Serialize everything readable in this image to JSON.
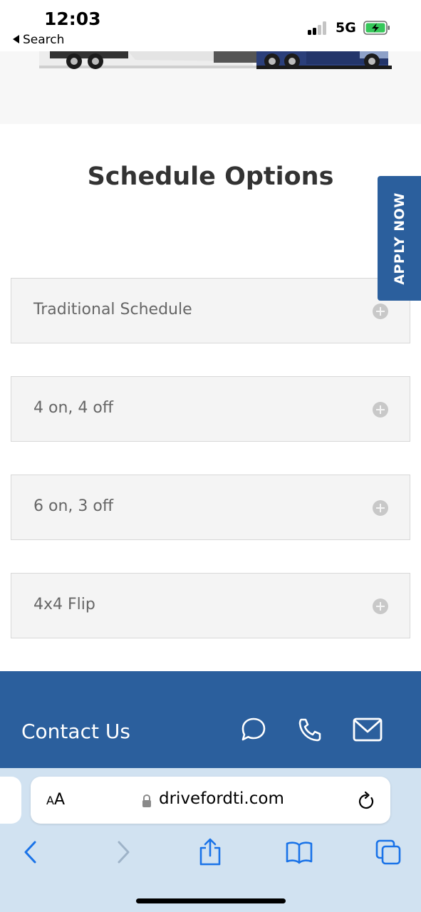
{
  "status_bar": {
    "time": "12:03",
    "back_label": "Search",
    "network": "5G",
    "signal_icon": "cellular-signal-icon",
    "battery_icon": "battery-charging-icon"
  },
  "hero": {
    "image": "semi-truck-trailer-photo"
  },
  "section": {
    "title": "Schedule Options",
    "apply_label": "APPLY NOW"
  },
  "accordion": [
    {
      "label": "Traditional Schedule",
      "icon": "plus-circle-icon"
    },
    {
      "label": "4 on, 4 off",
      "icon": "plus-circle-icon"
    },
    {
      "label": "6 on, 3 off",
      "icon": "plus-circle-icon"
    },
    {
      "label": "4x4 Flip",
      "icon": "plus-circle-icon"
    }
  ],
  "contact": {
    "title": "Contact Us",
    "icons": [
      "chat-bubble-icon",
      "phone-icon",
      "email-icon"
    ]
  },
  "browser": {
    "aa_small": "A",
    "aa_big": "A",
    "url": "drivefordti.com",
    "toolbar_icons": [
      "back-icon",
      "forward-icon",
      "share-icon",
      "bookmarks-icon",
      "tabs-icon"
    ]
  },
  "colors": {
    "brand_blue": "#2b5f9d",
    "accordion_bg": "#f4f4f4",
    "safari_chrome": "#d1e2f1",
    "ios_blue": "#1a73e8"
  }
}
